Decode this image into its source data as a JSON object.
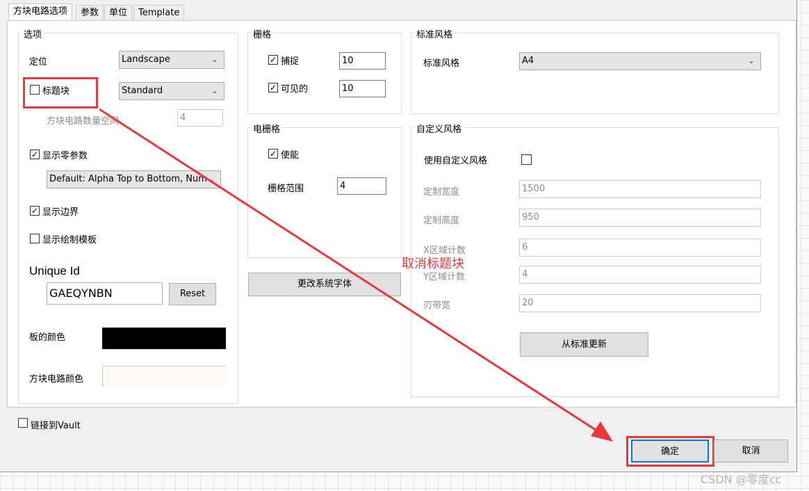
{
  "tabs": [
    "方块电路选项",
    "参数",
    "单位",
    "Template"
  ],
  "options": {
    "title": "选项",
    "orientation_label": "定位",
    "orientation_value": "Landscape",
    "title_block_label": "标题块",
    "title_block_checked": false,
    "title_block_style": "Standard",
    "sheet_count_label": "方块电路数量空间",
    "sheet_count_value": "4",
    "show_zero_params_label": "显示零参数",
    "show_zero_params_checked": true,
    "naming_value": "Default: Alpha Top to Bottom, Nume",
    "show_border_label": "显示边界",
    "show_border_checked": true,
    "show_template_label": "显示绘制模板",
    "show_template_checked": false,
    "unique_id_label": "Unique Id",
    "unique_id_value": "GAEQYNBN",
    "reset_label": "Reset",
    "board_color_label": "板的颜色",
    "board_color": "#000000",
    "sheet_color_label": "方块电路颜色",
    "sheet_color": "#fdfaf5"
  },
  "grid": {
    "title": "栅格",
    "snap_label": "捕捉",
    "snap_checked": true,
    "snap_value": "10",
    "visible_label": "可见的",
    "visible_checked": true,
    "visible_value": "10"
  },
  "electrical_grid": {
    "title": "电栅格",
    "enable_label": "使能",
    "enable_checked": true,
    "range_label": "栅格范围",
    "range_value": "4"
  },
  "change_font_label": "更改系统字体",
  "standard_style": {
    "title": "标准风格",
    "label": "标准风格",
    "value": "A4"
  },
  "custom_style": {
    "title": "自定义风格",
    "use_label": "使用自定义风格",
    "use_checked": false,
    "width_label": "定制宽度",
    "width_value": "1500",
    "height_label": "定制高度",
    "height_value": "950",
    "x_zones_label": "X区域计数",
    "x_zones_value": "6",
    "y_zones_label": "Y区域计数",
    "y_zones_value": "4",
    "margin_label": "刃带宽",
    "margin_value": "20",
    "update_label": "从标准更新"
  },
  "link_vault_label": "链接到Vault",
  "ok_label": "确定",
  "cancel_label": "取消",
  "annotation_text": "取消标题块",
  "annotation_color": "#e8383b",
  "watermark": "CSDN @零度cc"
}
